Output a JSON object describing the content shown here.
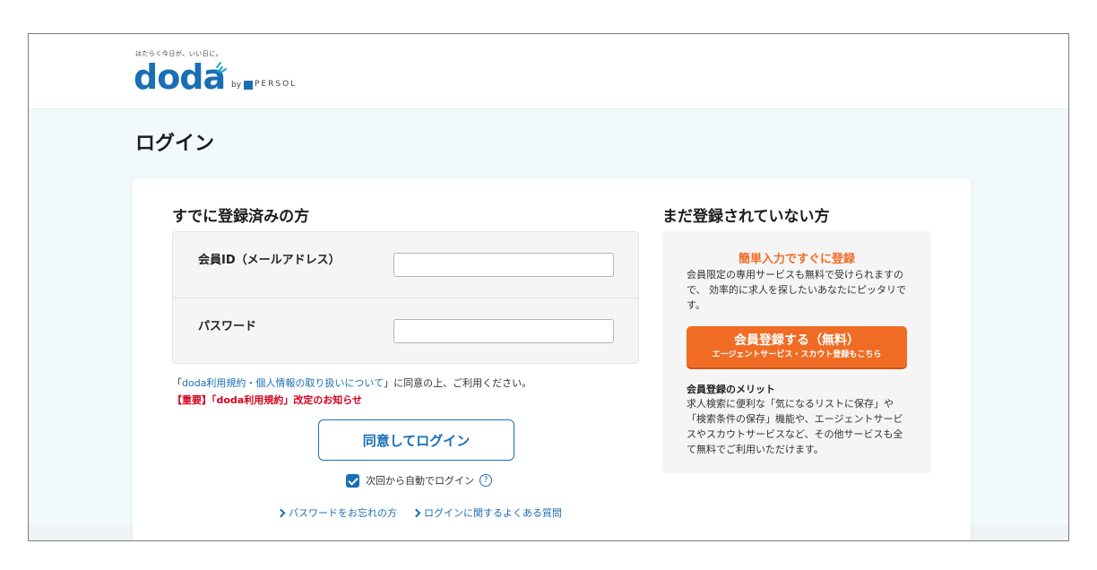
{
  "header": {
    "tagline": "はたらく今日が、いい日に。",
    "logo_text": "doda",
    "logo_by": "by",
    "logo_company": "PERSOL"
  },
  "page_title": "ログイン",
  "existing": {
    "title": "すでに登録済みの方",
    "member_id_label": "会員ID（メールアドレス）",
    "member_id_value": "",
    "password_label": "パスワード",
    "password_value": "",
    "terms_open": "「",
    "terms_link": "doda利用規約・個人情報の取り扱いについて",
    "terms_rest": "」に同意の上、ご利用ください。",
    "notice": "【重要】「doda利用規約」改定のお知らせ",
    "login_button": "同意してログイン",
    "auto_login_label": "次回から自動でログイン",
    "help_symbol": "?",
    "forgot_password_link": "パスワードをお忘れの方",
    "faq_link": "ログインに関するよくある質問"
  },
  "new_user": {
    "title": "まだ登録されていない方",
    "headline": "簡単入力ですぐに登録",
    "description": "会員限定の専用サービスも無料で受けられますので、 効率的に求人を探したいあなたにピッタリです。",
    "register_button_main": "会員登録する（無料）",
    "register_button_sub": "エージェントサービス・スカウト登録もこちら",
    "merit_title": "会員登録のメリット",
    "merit_description": "求人検索に便利な「気になるリストに保存」や「検索条件の保存」機能や、エージェントサービスやスカウトサービスなど、その他サービスも全て無料でご利用いただけます。"
  },
  "colors": {
    "brand_blue": "#1a6fb5",
    "accent_orange": "#f06c24",
    "notice_red": "#d6001c"
  }
}
